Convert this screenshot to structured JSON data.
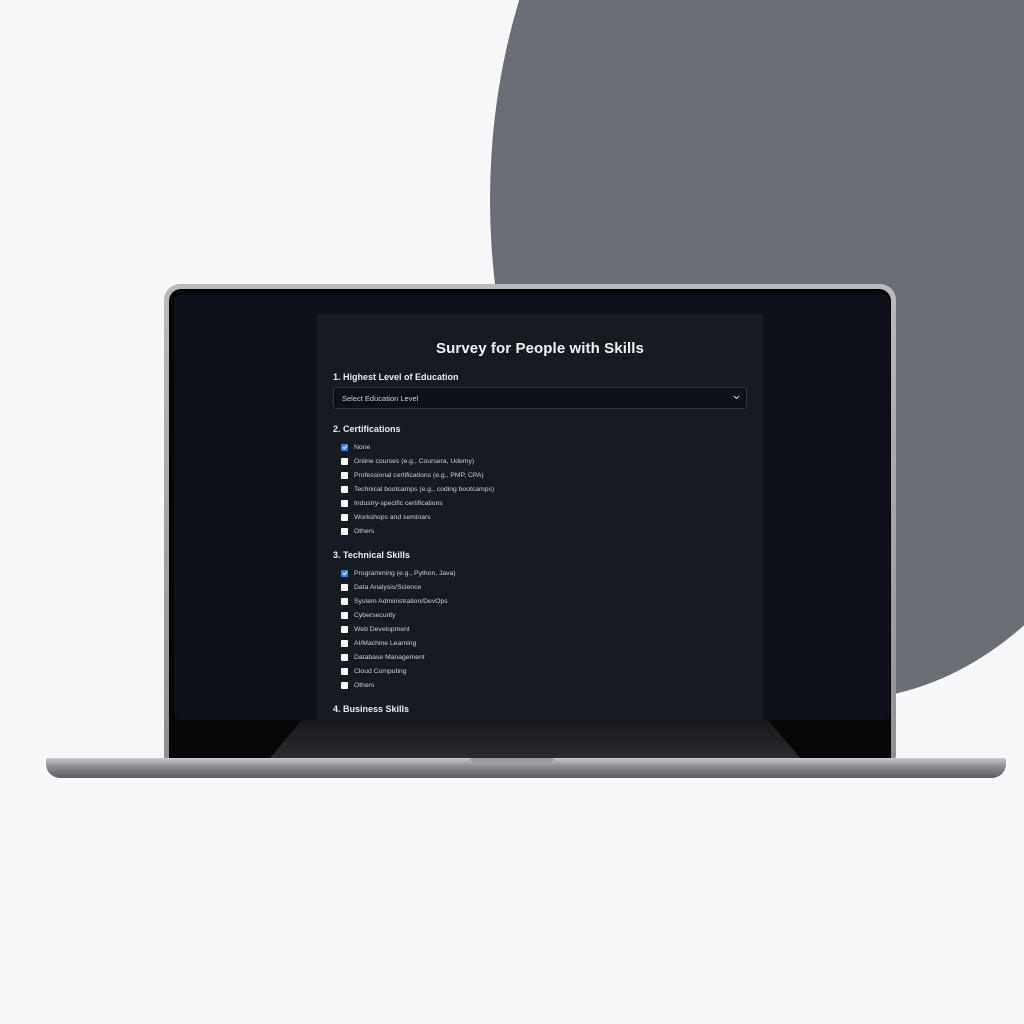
{
  "survey": {
    "title": "Survey for People with Skills",
    "education": {
      "heading": "1. Highest Level of Education",
      "select_value": "Select Education Level"
    },
    "certifications": {
      "heading": "2. Certifications",
      "options": [
        {
          "label": "None",
          "checked": true
        },
        {
          "label": "Online courses (e.g., Coursera, Udemy)",
          "checked": false
        },
        {
          "label": "Professional certifications (e.g., PMP, CPA)",
          "checked": false
        },
        {
          "label": "Technical bootcamps (e.g., coding bootcamps)",
          "checked": false
        },
        {
          "label": "Industry-specific certifications",
          "checked": false
        },
        {
          "label": "Workshops and seminars",
          "checked": false
        },
        {
          "label": "Others",
          "checked": false
        }
      ]
    },
    "technical_skills": {
      "heading": "3. Technical Skills",
      "options": [
        {
          "label": "Programming (e.g., Python, Java)",
          "checked": true
        },
        {
          "label": "Data Analysis/Science",
          "checked": false
        },
        {
          "label": "System Administration/DevOps",
          "checked": false
        },
        {
          "label": "Cybersecurity",
          "checked": false
        },
        {
          "label": "Web Development",
          "checked": false
        },
        {
          "label": "AI/Machine Learning",
          "checked": false
        },
        {
          "label": "Database Management",
          "checked": false
        },
        {
          "label": "Cloud Computing",
          "checked": false
        },
        {
          "label": "Others",
          "checked": false
        }
      ]
    },
    "business_skills": {
      "heading": "4. Business Skills"
    }
  },
  "icons": {
    "select": "chevron-down-icon",
    "checkbox_checked": "checkmark-icon"
  },
  "colors": {
    "accent": "#2f81f7",
    "panel": "#161b22",
    "screen": "#0d1117",
    "backdrop_circle": "#6b6e74"
  }
}
